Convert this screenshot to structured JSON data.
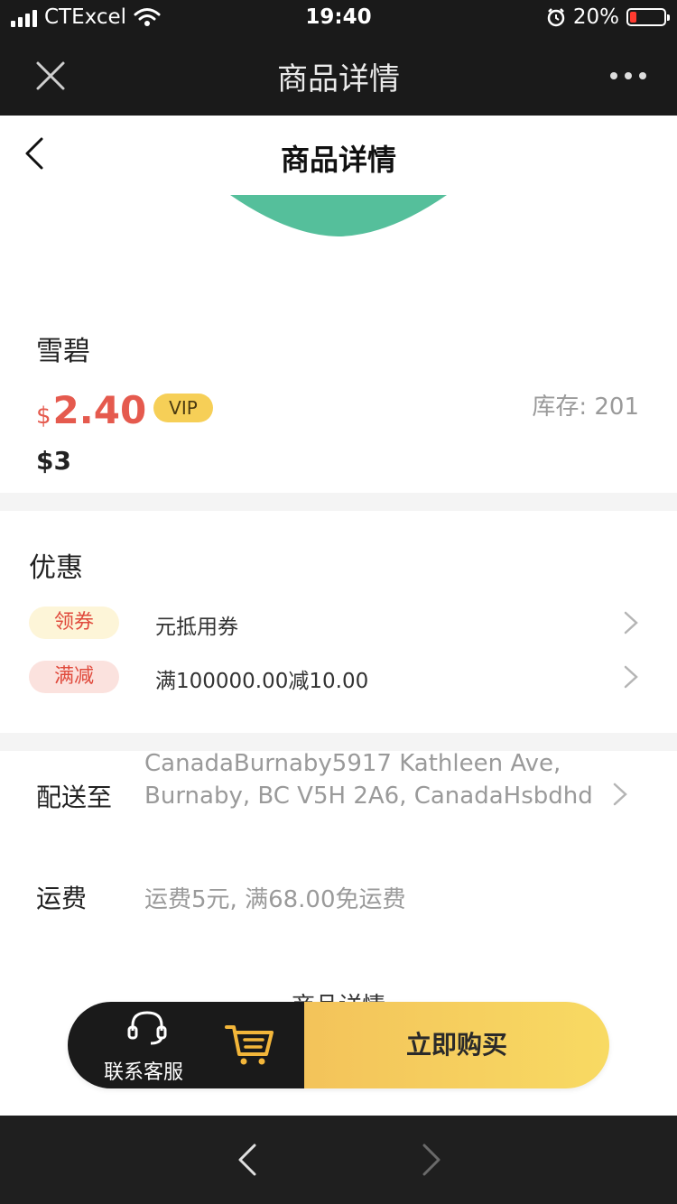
{
  "status_bar": {
    "carrier": "CTExcel",
    "time": "19:40",
    "battery": "20%",
    "battery_level": 0.2
  },
  "top_nav": {
    "title": "商品详情",
    "close_icon": "close-icon",
    "more_icon": "more-dots-icon"
  },
  "page_header": {
    "title": "商品详情",
    "back_icon": "chevron-left-icon"
  },
  "product": {
    "name": "雪碧",
    "price_symbol": "$",
    "price": "2.40",
    "vip_label": "VIP",
    "stock": "库存: 201",
    "original_price": "$3",
    "accent_color": "#e55a4e"
  },
  "discounts": {
    "title": "优惠",
    "items": [
      {
        "tag": "领券",
        "text": "元抵用券"
      },
      {
        "tag": "满减",
        "text": "满100000.00减10.00"
      }
    ]
  },
  "shipping": {
    "label": "配送至",
    "address": "CanadaBurnaby5917 Kathleen Ave, Burnaby, BC V5H 2A6, CanadaHsbdhd",
    "fee_label": "运费",
    "fee_text": "运费5元, 满68.00免运费"
  },
  "details_heading": "商品详情",
  "action_bar": {
    "service_label": "联系客服",
    "buy_label": "立即购买",
    "service_icon": "headset-icon",
    "cart_icon": "cart-icon"
  },
  "colors": {
    "dark": "#1a1a1a",
    "gold": "#f6cf57",
    "green_banner": "#55bf9b"
  }
}
